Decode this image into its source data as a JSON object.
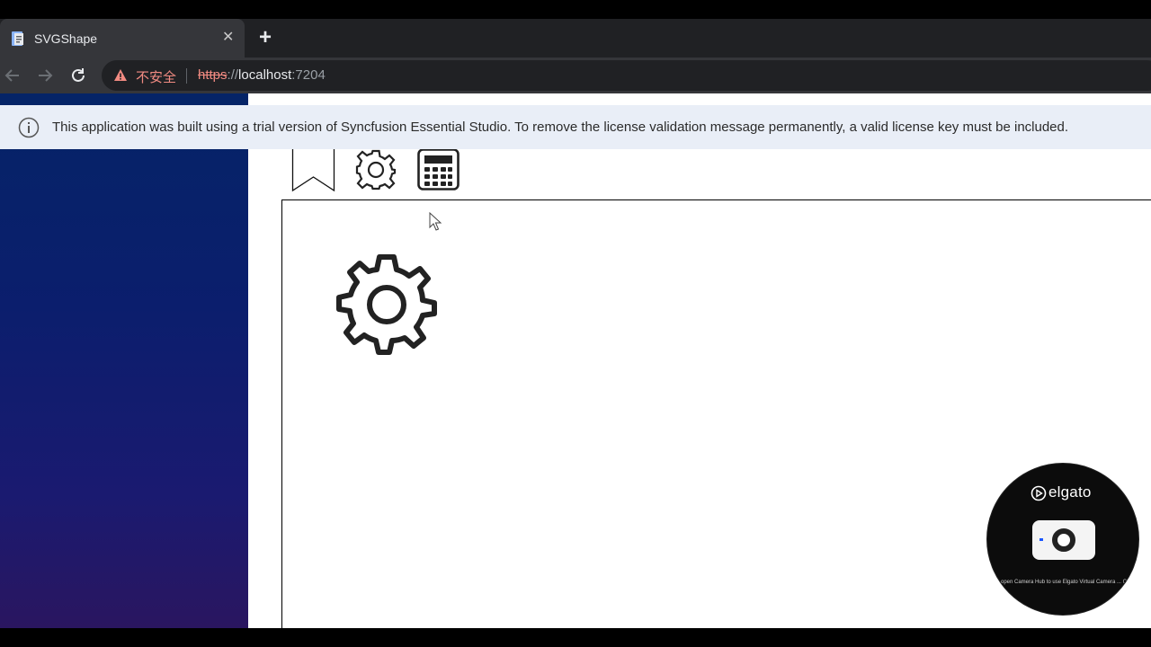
{
  "browser": {
    "tab": {
      "title": "SVGShape",
      "close_glyph": "✕"
    },
    "new_tab_glyph": "+",
    "address": {
      "security_label": "不安全",
      "scheme": "https",
      "separator": "://",
      "host": "localhost",
      "port": ":7204"
    },
    "icons": {
      "favicon": "page-icon",
      "back": "back-arrow-icon",
      "forward": "forward-arrow-icon",
      "reload": "reload-icon",
      "security": "warning-triangle-icon"
    }
  },
  "license_banner": {
    "icon": "info-icon",
    "text": "This application was built using a trial version of Syncfusion Essential Studio. To remove the license validation message permanently, a valid license key must be included."
  },
  "palette": {
    "items": [
      {
        "name": "bookmark",
        "icon": "bookmark-icon"
      },
      {
        "name": "settings",
        "icon": "gear-icon"
      },
      {
        "name": "calculator",
        "icon": "calculator-icon"
      }
    ]
  },
  "diagram": {
    "nodes": [
      {
        "icon": "gear-icon"
      }
    ]
  },
  "overlay": {
    "brand": "elgato",
    "message": "...open Camera Hub to use Elgato Virtual Camera ... Camera Hub ... camera ..."
  },
  "colors": {
    "chrome_dark": "#202124",
    "chrome_tab": "#35363a",
    "not_secure": "#f28b82",
    "license_bg": "#e9eef7",
    "sidebar_top": "#052467",
    "sidebar_bottom": "#2a1660"
  }
}
